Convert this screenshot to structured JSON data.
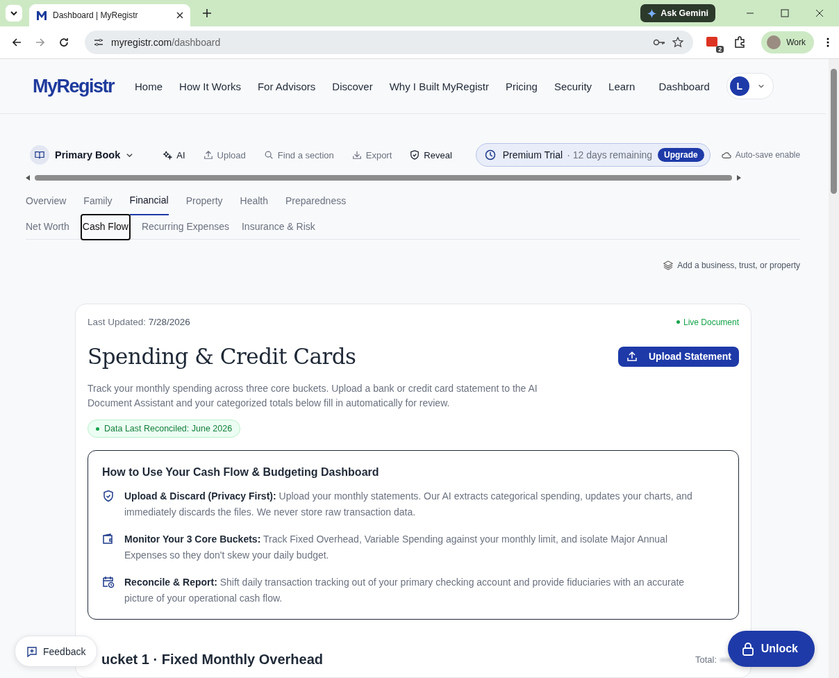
{
  "browser": {
    "tab_title": "Dashboard | MyRegistr",
    "gemini": "Ask Gemini",
    "url_host": "myregistr.com",
    "url_path": "/dashboard",
    "extension_badge": "2",
    "profile": "Work"
  },
  "nav": {
    "logo": "MyRegistr",
    "links": [
      "Home",
      "How It Works",
      "For Advisors",
      "Discover",
      "Why I Built MyRegistr",
      "Pricing",
      "Security",
      "Learn",
      "Dashboard"
    ],
    "avatar": "L"
  },
  "toolbar": {
    "book": "Primary Book",
    "actions": [
      {
        "kind": "sparkle",
        "label": "AI",
        "strong": true
      },
      {
        "kind": "upload",
        "label": "Upload",
        "strong": false
      },
      {
        "kind": "search",
        "label": "Find a section",
        "strong": false
      },
      {
        "kind": "download",
        "label": "Export",
        "strong": false
      },
      {
        "kind": "shield",
        "label": "Reveal",
        "strong": true
      }
    ],
    "trial": {
      "title": "Premium Trial",
      "detail": "· 12 days remaining",
      "button": "Upgrade"
    },
    "autosave": "Auto-save enable"
  },
  "tabs": [
    {
      "label": "Overview",
      "selected": false
    },
    {
      "label": "Family",
      "selected": false
    },
    {
      "label": "Financial",
      "selected": true
    },
    {
      "label": "Property",
      "selected": false
    },
    {
      "label": "Health",
      "selected": false
    },
    {
      "label": "Preparedness",
      "selected": false
    }
  ],
  "subtabs": [
    {
      "label": "Net Worth",
      "selected": false
    },
    {
      "label": "Cash Flow",
      "selected": true
    },
    {
      "label": "Recurring Expenses",
      "selected": false
    },
    {
      "label": "Insurance & Risk",
      "selected": false
    }
  ],
  "add_link": "Add a business, trust, or property",
  "card": {
    "last_updated_label": "Last Updated:",
    "last_updated": "7/28/2026",
    "live": "Live Document",
    "title": "Spending & Credit Cards",
    "upload_button": "Upload Statement",
    "description": "Track your monthly spending across three core buckets. Upload a bank or credit card statement to the AI Document Assistant and your categorized totals below fill in automatically for review.",
    "reconciled": "Data Last Reconciled: June 2026",
    "howto": {
      "title": "How to Use Your Cash Flow & Budgeting Dashboard",
      "items": [
        {
          "kind": "shield",
          "lead": "Upload & Discard (Privacy First):",
          "text": "Upload your monthly statements. Our AI extracts categorical spending, updates your charts, and immediately discards the files. We never store raw transaction data."
        },
        {
          "kind": "wallet",
          "lead": "Monitor Your 3 Core Buckets:",
          "text": "Track Fixed Overhead, Variable Spending against your monthly limit, and isolate Major Annual Expenses so they don't skew your daily budget."
        },
        {
          "kind": "calendar",
          "lead": "Reconcile & Report:",
          "text": "Shift daily transaction tracking out of your primary checking account and provide fiduciaries with an accurate picture of your operational cash flow."
        }
      ]
    },
    "bucket_title": "ucket 1 · Fixed Monthly Overhead",
    "total_label": "Total:"
  },
  "feedback": "Feedback",
  "unlock": "Unlock"
}
